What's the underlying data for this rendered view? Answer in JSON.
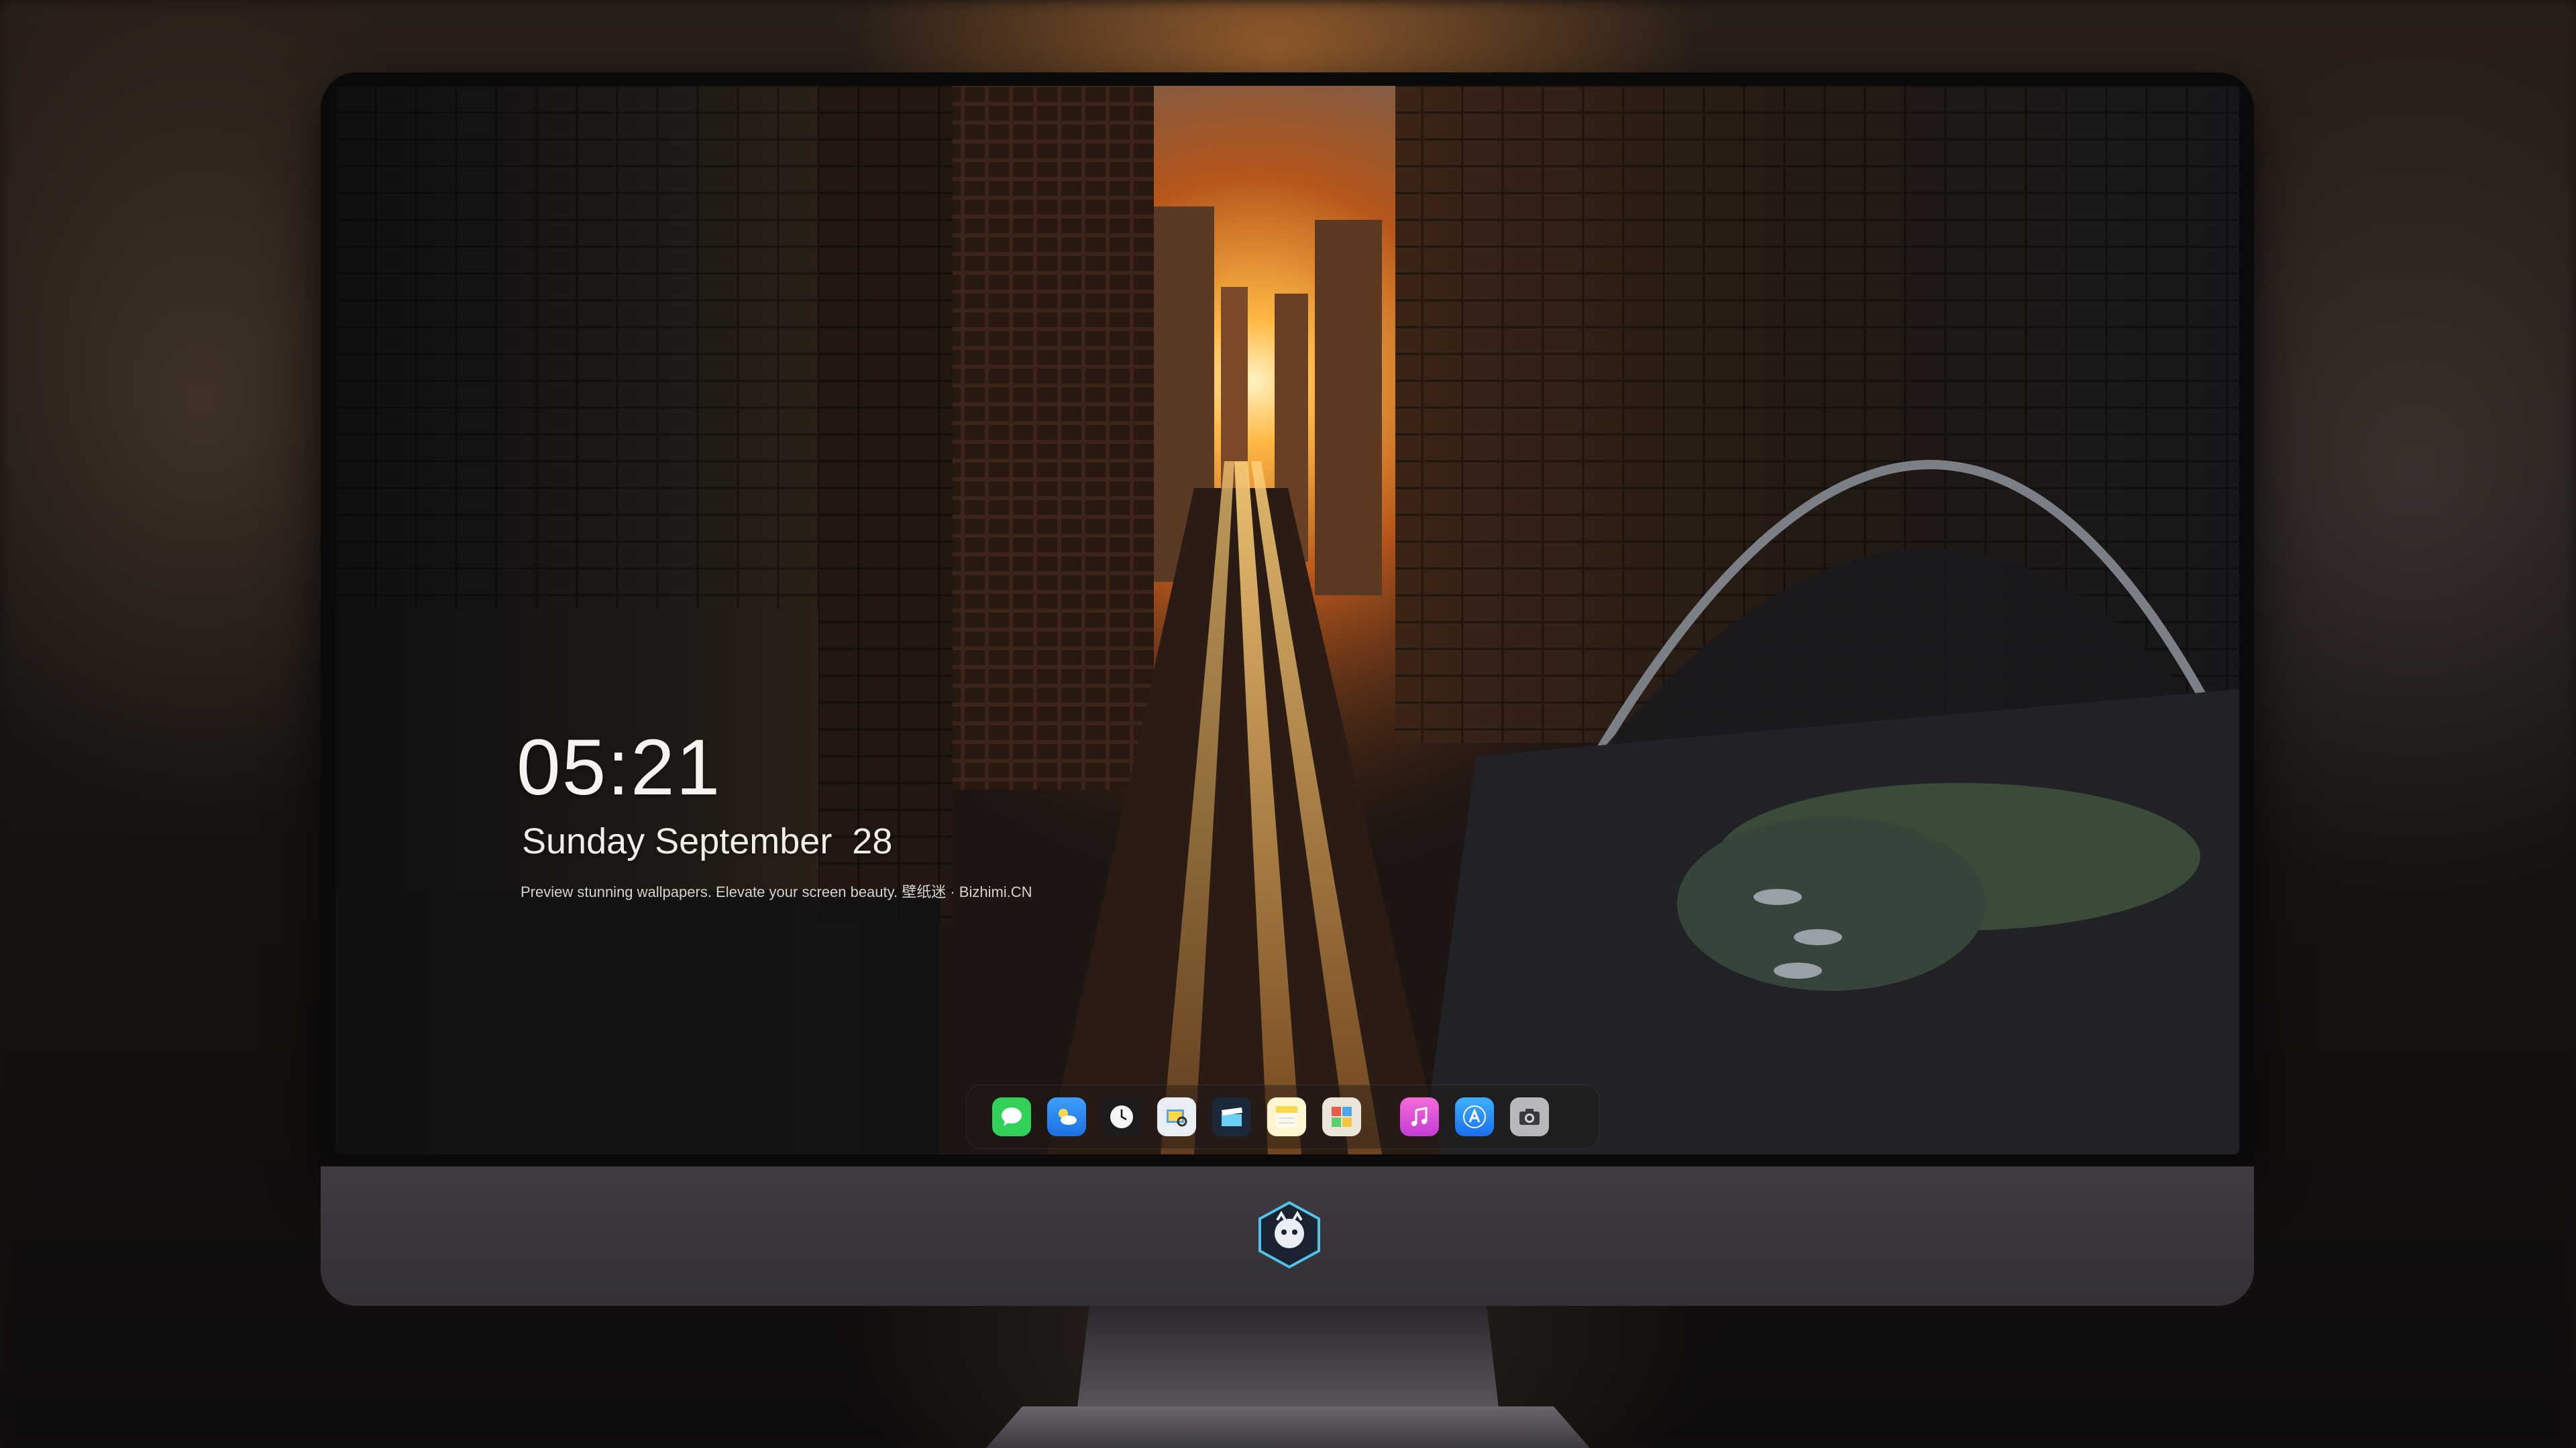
{
  "lock_screen": {
    "time": "05:21",
    "date": "Sunday September  28",
    "caption": "Preview stunning wallpapers. Elevate your screen beauty. 壁纸迷 · Bizhimi.CN"
  },
  "dock": {
    "apps": [
      {
        "icon": "messages-icon",
        "color": "#2fd158"
      },
      {
        "icon": "weather-icon",
        "color": "#2f8cf0"
      },
      {
        "icon": "clock-icon",
        "color": "#f2f2f2"
      },
      {
        "icon": "preview-icon",
        "color": "#f5c542"
      },
      {
        "icon": "final-cut-icon",
        "color": "#6ad0f3"
      },
      {
        "icon": "notes-icon",
        "color": "#ffd84a"
      },
      {
        "icon": "photo-booth-icon",
        "color": "#e8e2d8"
      },
      {
        "icon": "music-icon",
        "color": "#e94fd0"
      },
      {
        "icon": "app-store-icon",
        "color": "#2e8cf5"
      },
      {
        "icon": "camera-icon",
        "color": "#8c8c90"
      }
    ]
  },
  "colors": {
    "chin": "#3a363c",
    "bezel": "#0a0a0b",
    "sunset": "#f3a23a"
  }
}
